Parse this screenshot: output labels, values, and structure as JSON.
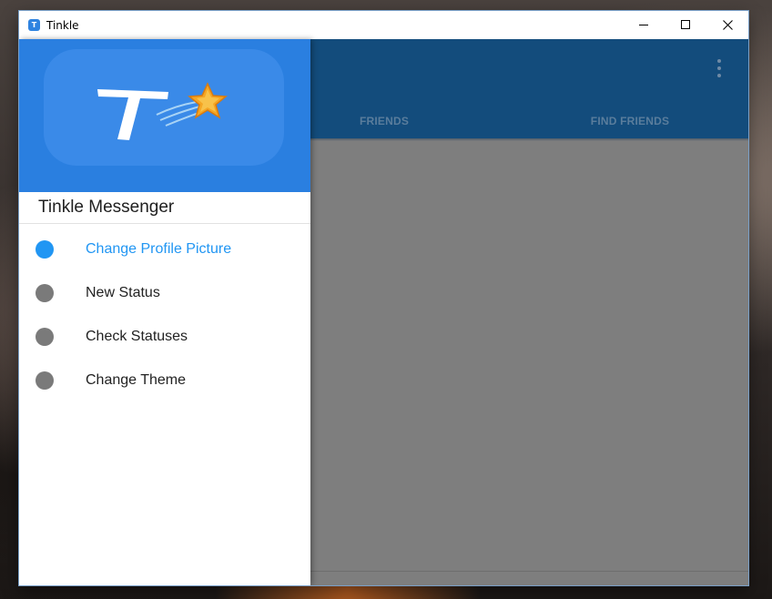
{
  "window": {
    "title": "Tinkle",
    "icon": "tinkle-app-icon",
    "icon_glyph": "T",
    "controls": [
      "minimize-icon",
      "maximize-icon",
      "close-icon"
    ]
  },
  "appbar": {
    "tabs": [
      {
        "label": "FRIENDS"
      },
      {
        "label": "FIND FRIENDS"
      }
    ],
    "menu_icon": "more-vert-icon"
  },
  "drawer": {
    "logo_icon": "tinkle-star-logo",
    "app_name": "Tinkle Messenger",
    "items": [
      {
        "label": "Change Profile Picture",
        "icon": "dot-icon",
        "active": true
      },
      {
        "label": "New Status",
        "icon": "dot-icon",
        "active": false
      },
      {
        "label": "Check Statuses",
        "icon": "dot-icon",
        "active": false
      },
      {
        "label": "Change Theme",
        "icon": "dot-icon",
        "active": false
      }
    ]
  },
  "colors": {
    "accent": "#2196f3",
    "drawer_header": "#2a7fe0",
    "appbar": "#134c7c",
    "scrim": "#7e7e7e"
  }
}
